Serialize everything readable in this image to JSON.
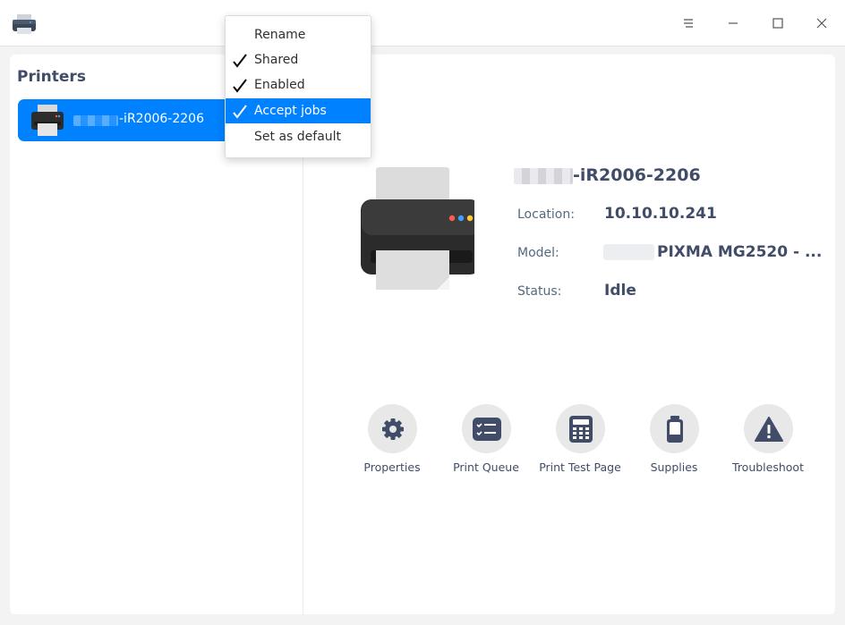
{
  "titlebar": {
    "app_icon": "printer-app-icon",
    "buttons": [
      "menu-icon",
      "minimize-icon",
      "maximize-icon",
      "close-icon"
    ]
  },
  "sidebar": {
    "title": "Printers",
    "items": [
      {
        "name": "-iR2006-2206",
        "selected": true,
        "icon": "printer-icon"
      }
    ]
  },
  "context_menu": {
    "items": [
      {
        "label": "Rename",
        "checked": false,
        "highlighted": false
      },
      {
        "label": "Shared",
        "checked": true,
        "highlighted": false
      },
      {
        "label": "Enabled",
        "checked": true,
        "highlighted": false
      },
      {
        "label": "Accept jobs",
        "checked": true,
        "highlighted": true
      },
      {
        "label": "Set as default",
        "checked": false,
        "highlighted": false
      }
    ]
  },
  "details": {
    "name": "-iR2006-2206",
    "location_label": "Location:",
    "location_value": "10.10.10.241",
    "model_label": "Model:",
    "model_value": "PIXMA MG2520 - ...",
    "status_label": "Status:",
    "status_value": "Idle"
  },
  "actions": [
    {
      "label": "Properties",
      "icon": "gear-icon"
    },
    {
      "label": "Print Queue",
      "icon": "print-queue-icon"
    },
    {
      "label": "Print Test Page",
      "icon": "calculator-test-page-icon"
    },
    {
      "label": "Supplies",
      "icon": "cartridge-icon"
    },
    {
      "label": "Troubleshoot",
      "icon": "warning-icon"
    }
  ],
  "colors": {
    "accent": "#0081ff",
    "text": "#414d68",
    "icon_dark": "#414d68",
    "action_bg": "#e8e8e8"
  }
}
